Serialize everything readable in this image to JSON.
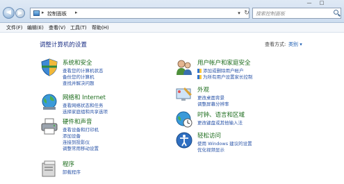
{
  "address": {
    "path": "控制面板"
  },
  "search": {
    "placeholder": "搜索控制面板"
  },
  "menu": [
    "文件(F)",
    "编辑(E)",
    "查看(V)",
    "工具(T)",
    "帮助(H)"
  ],
  "heading": "调整计算机的设置",
  "view_by": {
    "label": "查看方式:",
    "value": "类别 ▾"
  },
  "categories": [
    {
      "title": "系统和安全",
      "links": [
        "查看您的计算机状态",
        "备份您的计算机",
        "查找并解决问题"
      ]
    },
    {
      "title": "网络和 Internet",
      "links": [
        "查看网络状态和任务",
        "选择家庭组和共享选项"
      ]
    },
    {
      "title": "硬件和声音",
      "links": [
        "查看设备和打印机",
        "添加设备",
        "连接到投影仪",
        "调整常用移动设置"
      ]
    },
    {
      "title": "程序",
      "links": [
        "卸载程序"
      ]
    },
    {
      "title": "用户帐户和家庭安全",
      "links": [
        "添加或删除用户帐户",
        "为所有用户设置家长控制"
      ]
    },
    {
      "title": "外观",
      "links": [
        "更改桌面背景",
        "调整屏幕分辨率"
      ]
    },
    {
      "title": "时钟、语言和区域",
      "links": [
        "更改键盘或其他输入法"
      ]
    },
    {
      "title": "轻松访问",
      "links": [
        "使用 Windows 建议的设置",
        "优化视频显示"
      ]
    }
  ]
}
